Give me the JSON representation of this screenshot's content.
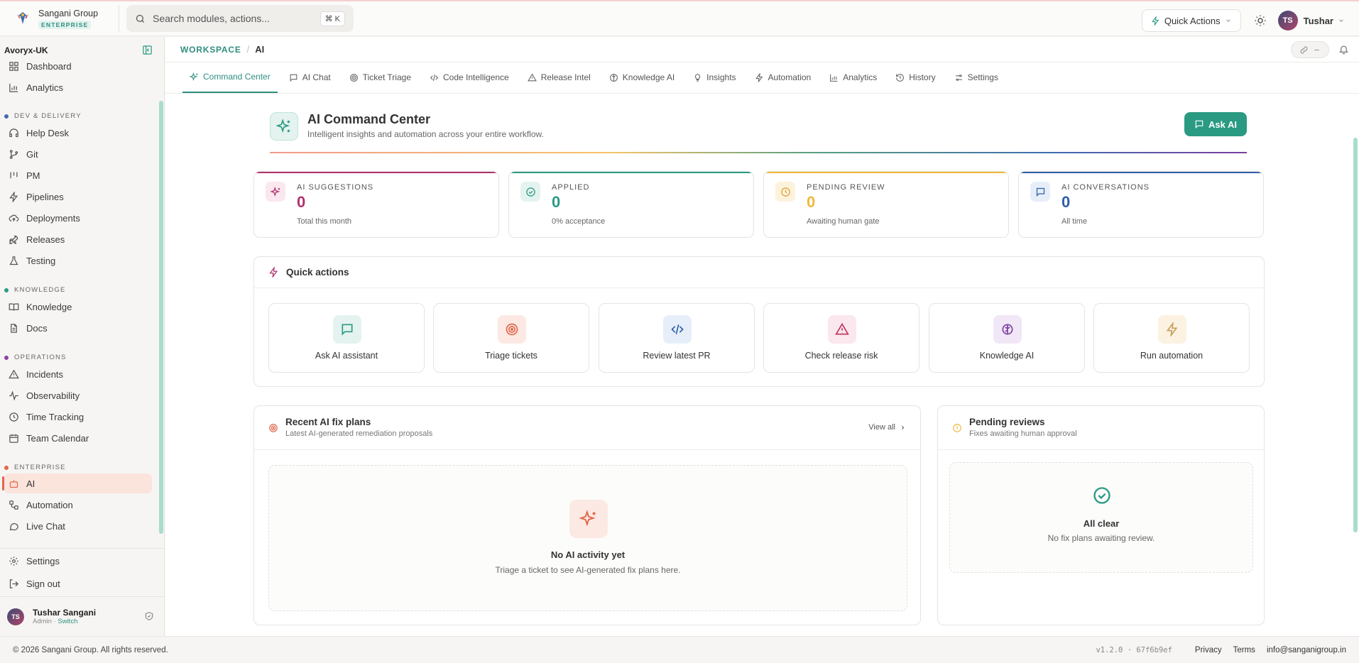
{
  "brand": {
    "name": "Sangani Group",
    "tag": "ENTERPRISE"
  },
  "search": {
    "placeholder": "Search modules, actions...",
    "shortcut": "⌘ K"
  },
  "topbar": {
    "quick_actions_label": "Quick Actions",
    "user_initials": "TS",
    "user_name": "Tushar"
  },
  "sidebar": {
    "org": "Avoryx-UK",
    "items_top": [
      {
        "label": "Dashboard",
        "icon": "dashboard-icon"
      },
      {
        "label": "Analytics",
        "icon": "bar-chart-icon"
      }
    ],
    "sections": [
      {
        "title": "DEV & DELIVERY",
        "color": "#3d6cb0",
        "items": [
          "Help Desk",
          "Git",
          "PM",
          "Pipelines",
          "Deployments",
          "Releases",
          "Testing"
        ]
      },
      {
        "title": "KNOWLEDGE",
        "color": "#2a9a83",
        "items": [
          "Knowledge",
          "Docs"
        ]
      },
      {
        "title": "OPERATIONS",
        "color": "#8e3fa8",
        "items": [
          "Incidents",
          "Observability",
          "Time Tracking",
          "Team Calendar"
        ]
      },
      {
        "title": "ENTERPRISE",
        "color": "#e0674a",
        "items": [
          "AI",
          "Automation",
          "Live Chat"
        ]
      }
    ],
    "bottom_items": [
      "Settings",
      "Sign out"
    ],
    "user": {
      "initials": "TS",
      "name": "Tushar Sangani",
      "role": "Admin · ",
      "switch": "Switch"
    }
  },
  "breadcrumb": {
    "workspace": "WORKSPACE",
    "sep": "/",
    "page": "AI"
  },
  "tabs": [
    "Command Center",
    "AI Chat",
    "Ticket Triage",
    "Code Intelligence",
    "Release Intel",
    "Knowledge AI",
    "Insights",
    "Automation",
    "Analytics",
    "History",
    "Settings"
  ],
  "hero": {
    "title": "AI Command Center",
    "subtitle": "Intelligent insights and automation across your entire workflow.",
    "ask_label": "Ask AI"
  },
  "stats": [
    {
      "label": "AI SUGGESTIONS",
      "value": "0",
      "note": "Total this month",
      "color": "#b0326f",
      "bg": "#fbe7ef"
    },
    {
      "label": "APPLIED",
      "value": "0",
      "note": "0% acceptance",
      "color": "#2a9a83",
      "bg": "#e4f3ef"
    },
    {
      "label": "PENDING REVIEW",
      "value": "0",
      "note": "Awaiting human gate",
      "color": "#f0b93d",
      "bg": "#fdf2dc"
    },
    {
      "label": "AI CONVERSATIONS",
      "value": "0",
      "note": "All time",
      "color": "#2f5ea8",
      "bg": "#e6eef9"
    }
  ],
  "quick_actions": {
    "title": "Quick actions",
    "items": [
      {
        "label": "Ask AI assistant",
        "color": "#2a9a83",
        "bg": "#e4f3ef"
      },
      {
        "label": "Triage tickets",
        "color": "#e0674a",
        "bg": "#fce9e3"
      },
      {
        "label": "Review latest PR",
        "color": "#2f5ea8",
        "bg": "#e6eef9"
      },
      {
        "label": "Check release risk",
        "color": "#c0335d",
        "bg": "#fbe7ee"
      },
      {
        "label": "Knowledge AI",
        "color": "#7a3fa0",
        "bg": "#f1e7f7"
      },
      {
        "label": "Run automation",
        "color": "#c9a05a",
        "bg": "#fbf2e2"
      }
    ]
  },
  "recent": {
    "title": "Recent AI fix plans",
    "subtitle": "Latest AI-generated remediation proposals",
    "view_all": "View all",
    "empty_title": "No AI activity yet",
    "empty_sub": "Triage a ticket to see AI-generated fix plans here."
  },
  "pending": {
    "title": "Pending reviews",
    "subtitle": "Fixes awaiting human approval",
    "empty_title": "All clear",
    "empty_sub": "No fix plans awaiting review."
  },
  "footer": {
    "copyright": "© 2026 Sangani Group. All rights reserved.",
    "version": "v1.2.0 · 67f6b9ef",
    "links": [
      "Privacy",
      "Terms",
      "info@sanganigroup.in"
    ]
  }
}
